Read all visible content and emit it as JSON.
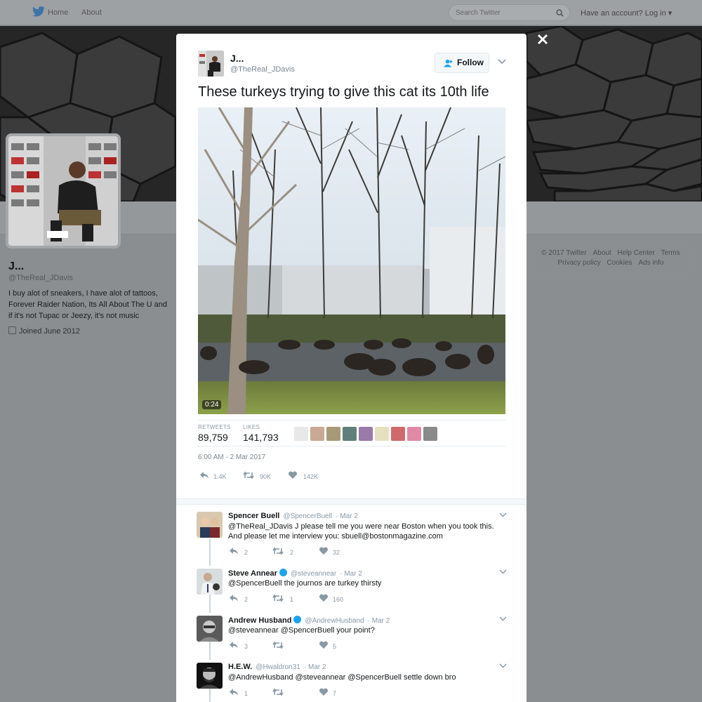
{
  "nav": {
    "home": "Home",
    "about": "About",
    "search_placeholder": "Search Twitter",
    "login": "Have an account? Log in"
  },
  "profile": {
    "name": "J...",
    "handle": "@TheReal_JDavis",
    "bio": "I buy alot of sneakers, I have alot of tattoos, Forever Raider Nation, Its All About The U and if it's not Tupac or Jeezy, it's not music",
    "joined": "Joined June 2012"
  },
  "footer": {
    "links_line1": [
      "© 2017 Twitter",
      "About",
      "Help Center",
      "Terms"
    ],
    "links_line2": [
      "Privacy policy",
      "Cookies",
      "Ads info"
    ]
  },
  "tweet": {
    "name": "J...",
    "handle": "@TheReal_JDavis",
    "follow_label": "Follow",
    "text": "These turkeys trying to give this cat its 10th life",
    "video_duration": "0:24",
    "retweets_label": "RETWEETS",
    "retweets": "89,759",
    "likes_label": "LIKES",
    "likes": "141,793",
    "timestamp": "6:00 AM - 2 Mar 2017",
    "reply_count": "1.4K",
    "retweet_count": "90K",
    "like_count": "142K"
  },
  "replies": [
    {
      "name": "Spencer Buell",
      "handle": "@SpencerBuell",
      "date": "· Mar 2",
      "verified": false,
      "text": "@TheReal_JDavis J please tell me you were near Boston when you took this. And please let me interview you: sbuell@bostonmagazine.com",
      "reply_count": "2",
      "retweet_count": "2",
      "like_count": "32"
    },
    {
      "name": "Steve Annear",
      "handle": "@steveannear",
      "date": "· Mar 2",
      "verified": true,
      "text": "@SpencerBuell the journos are turkey thirsty",
      "reply_count": "2",
      "retweet_count": "1",
      "like_count": "160"
    },
    {
      "name": "Andrew Husband",
      "handle": "@AndrewHusband",
      "date": "· Mar 2",
      "verified": true,
      "text": "@steveannear @SpencerBuell your point?",
      "reply_count": "3",
      "retweet_count": "",
      "like_count": "5"
    },
    {
      "name": "H.E.W.",
      "handle": "@Hwaldron31",
      "date": "· Mar 2",
      "verified": false,
      "text": "@AndrewHusband @steveannear @SpencerBuell settle down bro",
      "reply_count": "1",
      "retweet_count": "",
      "like_count": "7"
    }
  ]
}
